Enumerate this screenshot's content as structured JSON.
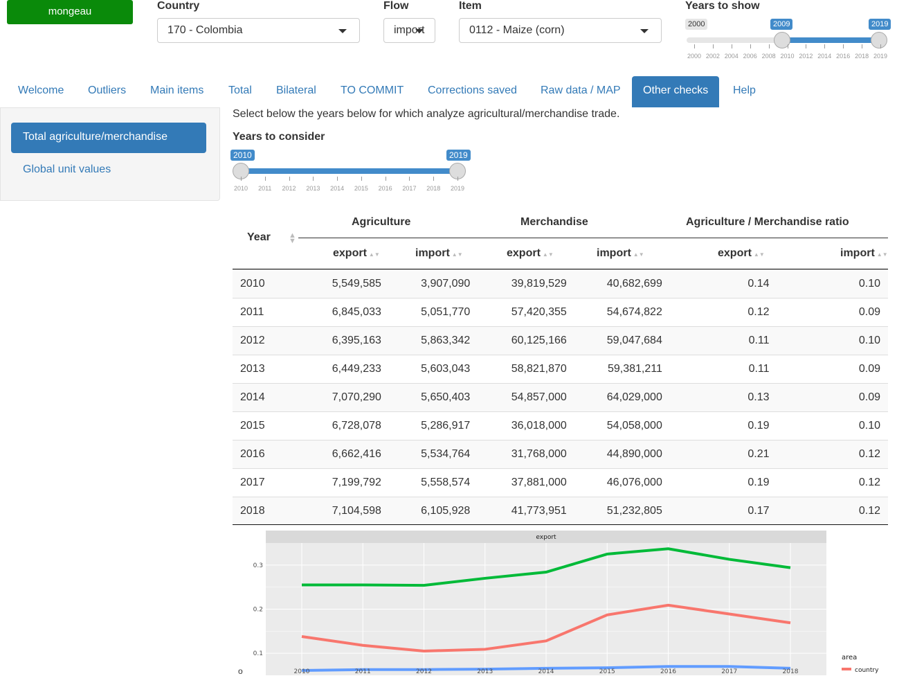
{
  "header": {
    "user_button": "mongeau",
    "country": {
      "label": "Country",
      "value": "170 - Colombia"
    },
    "flow": {
      "label": "Flow",
      "value": "import"
    },
    "item": {
      "label": "Item",
      "value": "0112 - Maize (corn)"
    },
    "years": {
      "label": "Years to show",
      "min": "2000",
      "from": "2009",
      "to": "2019",
      "ticks": [
        "2000",
        "2002",
        "2004",
        "2006",
        "2008",
        "2010",
        "2012",
        "2014",
        "2016",
        "2018",
        "2019"
      ]
    }
  },
  "tabs": [
    "Welcome",
    "Outliers",
    "Main items",
    "Total",
    "Bilateral",
    "TO COMMIT",
    "Corrections saved",
    "Raw data / MAP",
    "Other checks",
    "Help"
  ],
  "active_tab": "Other checks",
  "sidebar": {
    "items": [
      "Total agriculture/merchandise",
      "Global unit values"
    ]
  },
  "main": {
    "intro": "Select below the years below for which analyze agricultural/merchandise trade.",
    "years_label": "Years to consider",
    "years_from": "2010",
    "years_to": "2019",
    "year_ticks": [
      "2010",
      "2011",
      "2012",
      "2013",
      "2014",
      "2015",
      "2016",
      "2017",
      "2018",
      "2019"
    ]
  },
  "table": {
    "groups": [
      "Agriculture",
      "Merchandise",
      "Agriculture / Merchandise ratio"
    ],
    "year_header": "Year",
    "sub_headers": [
      "export",
      "import",
      "export",
      "import",
      "export",
      "import"
    ],
    "rows": [
      [
        "2010",
        "5,549,585",
        "3,907,090",
        "39,819,529",
        "40,682,699",
        "0.14",
        "0.10"
      ],
      [
        "2011",
        "6,845,033",
        "5,051,770",
        "57,420,355",
        "54,674,822",
        "0.12",
        "0.09"
      ],
      [
        "2012",
        "6,395,163",
        "5,863,342",
        "60,125,166",
        "59,047,684",
        "0.11",
        "0.10"
      ],
      [
        "2013",
        "6,449,233",
        "5,603,043",
        "58,821,870",
        "59,381,211",
        "0.11",
        "0.09"
      ],
      [
        "2014",
        "7,070,290",
        "5,650,403",
        "54,857,000",
        "64,029,000",
        "0.13",
        "0.09"
      ],
      [
        "2015",
        "6,728,078",
        "5,286,917",
        "36,018,000",
        "54,058,000",
        "0.19",
        "0.10"
      ],
      [
        "2016",
        "6,662,416",
        "5,534,764",
        "31,768,000",
        "44,890,000",
        "0.21",
        "0.12"
      ],
      [
        "2017",
        "7,199,792",
        "5,558,574",
        "37,881,000",
        "46,076,000",
        "0.19",
        "0.12"
      ],
      [
        "2018",
        "7,104,598",
        "6,105,928",
        "41,773,951",
        "51,232,805",
        "0.17",
        "0.12"
      ]
    ]
  },
  "chart_data": {
    "type": "line",
    "title": "export",
    "x": [
      2010,
      2011,
      2012,
      2013,
      2014,
      2015,
      2016,
      2017,
      2018
    ],
    "yticks": [
      "0.1",
      "0.2",
      "0.3"
    ],
    "ylim": [
      0.05,
      0.35
    ],
    "legend_title": "area",
    "series": [
      {
        "name": "",
        "color": "#00ba38",
        "values": [
          0.255,
          0.255,
          0.254,
          0.27,
          0.284,
          0.325,
          0.337,
          0.313,
          0.294
        ]
      },
      {
        "name": "country",
        "color": "#f8766d",
        "values": [
          0.138,
          0.118,
          0.105,
          0.109,
          0.128,
          0.187,
          0.209,
          0.189,
          0.169
        ]
      },
      {
        "name": "",
        "color": "#619cff",
        "values": [
          0.061,
          0.063,
          0.063,
          0.064,
          0.066,
          0.067,
          0.07,
          0.07,
          0.066
        ]
      }
    ],
    "grid": true,
    "legend_position": "right"
  }
}
